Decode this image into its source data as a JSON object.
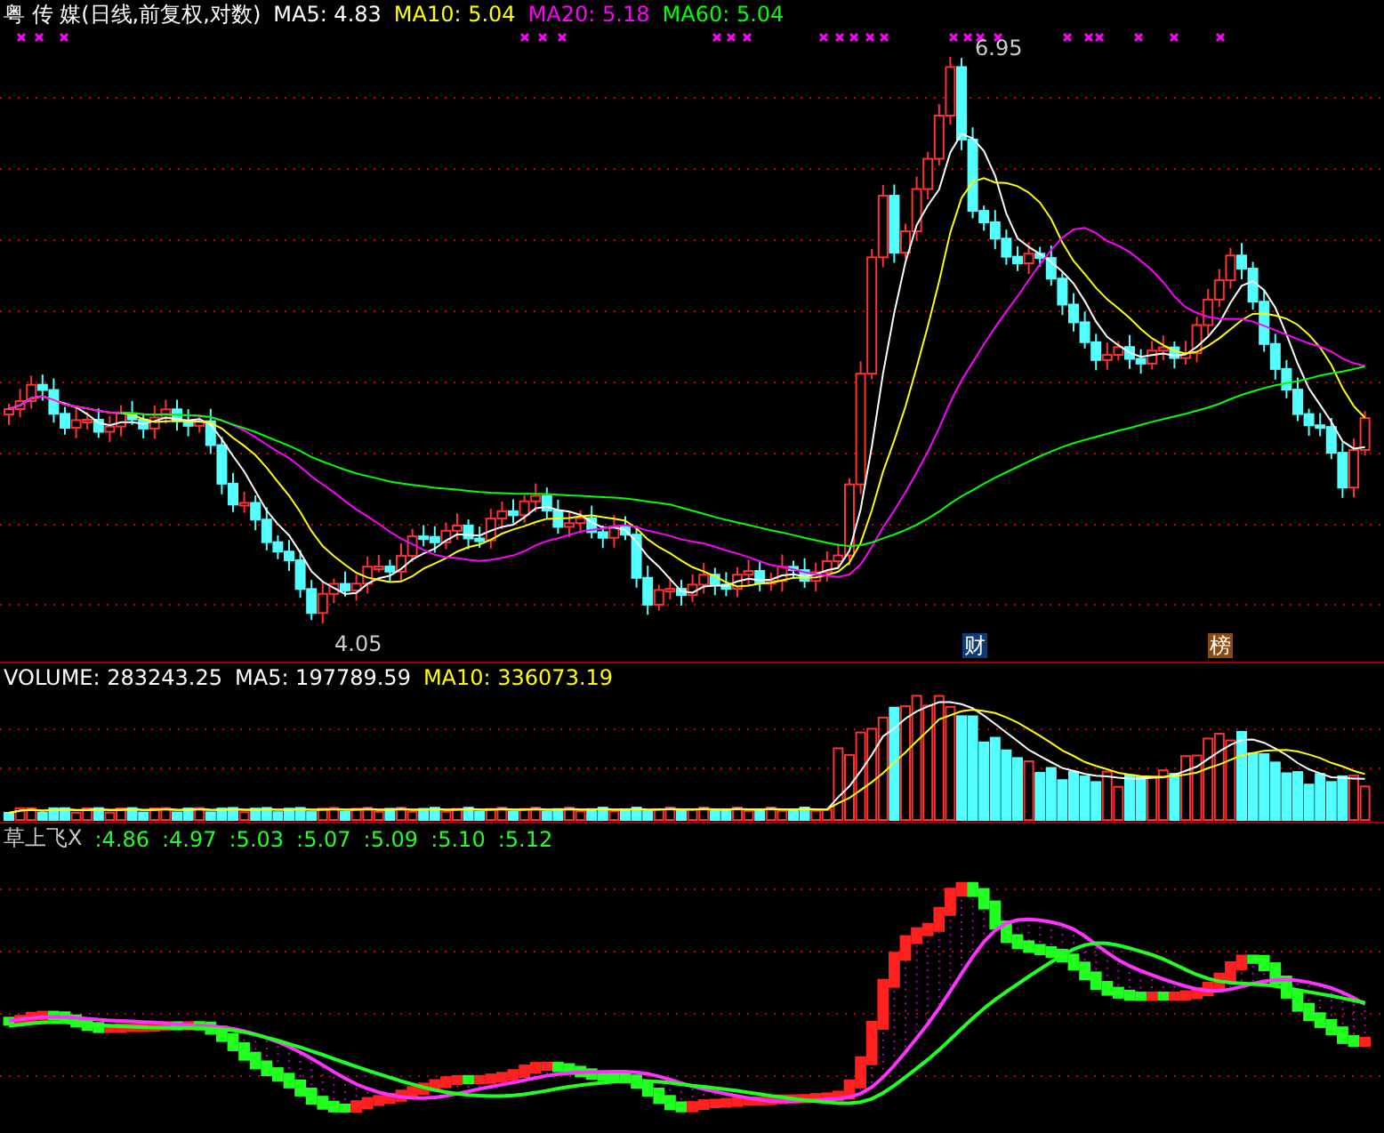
{
  "price_panel": {
    "security": "粤 传 媒(日线,前复权,对数)",
    "indicators": [
      {
        "label": "MA5: 4.83",
        "color": "#ffffff"
      },
      {
        "label": "MA10: 5.04",
        "color": "#ffff00"
      },
      {
        "label": "MA20: 5.18",
        "color": "#ff00ff"
      },
      {
        "label": "MA60: 5.04",
        "color": "#00ff00"
      }
    ],
    "high_label": "6.95",
    "low_label": "4.05",
    "badges": [
      {
        "text": "财",
        "color": "#0d3b78"
      },
      {
        "text": "榜",
        "color": "#8a4b12"
      }
    ]
  },
  "volume_panel": {
    "indicators": [
      {
        "label": "VOLUME: 283243.25",
        "color": "#ffffff"
      },
      {
        "label": "MA5: 197789.59",
        "color": "#ffffff"
      },
      {
        "label": "MA10: 336073.19",
        "color": "#ffff00"
      }
    ]
  },
  "indicator_panel": {
    "title": "草上飞X",
    "values": [
      ":4.86",
      ":4.97",
      ":5.03",
      ":5.07",
      ":5.09",
      ":5.10",
      ":5.12"
    ]
  }
}
